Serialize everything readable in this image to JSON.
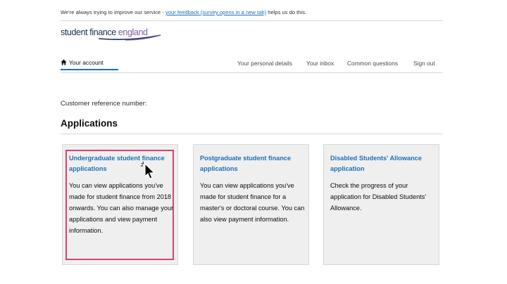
{
  "feedback_banner": {
    "prefix": "We're always trying to improve our service - ",
    "link": "your feedback (survey opens in a new tab)",
    "suffix": " helps us do this."
  },
  "logo": {
    "part1": "student finance ",
    "part2": "england"
  },
  "nav": {
    "home": {
      "label": "Your account",
      "icon": "home-icon"
    },
    "items": [
      "Your personal details",
      "Your inbox",
      "Common questions",
      "Sign out"
    ]
  },
  "customer_reference_label": "Customer reference number:",
  "applications_heading": "Applications",
  "cards": [
    {
      "title": "Undergraduate student finance applications",
      "body": "You can view applications you've made for student finance from 2018 onwards. You can also manage your applications and view payment information.",
      "highlighted": true
    },
    {
      "title": "Postgraduate student finance applications",
      "body": "You can view applications you've made for student finance for a master's or doctoral course. You can also view payment information."
    },
    {
      "title": "Disabled Students' Allowance application",
      "body": "Check the progress of your application for Disabled Students' Allowance."
    }
  ],
  "colors": {
    "link": "#1d70b8",
    "highlight": "#d4456f",
    "card_bg": "#efefef"
  },
  "cursor_icon": "pointer-cursor-icon"
}
